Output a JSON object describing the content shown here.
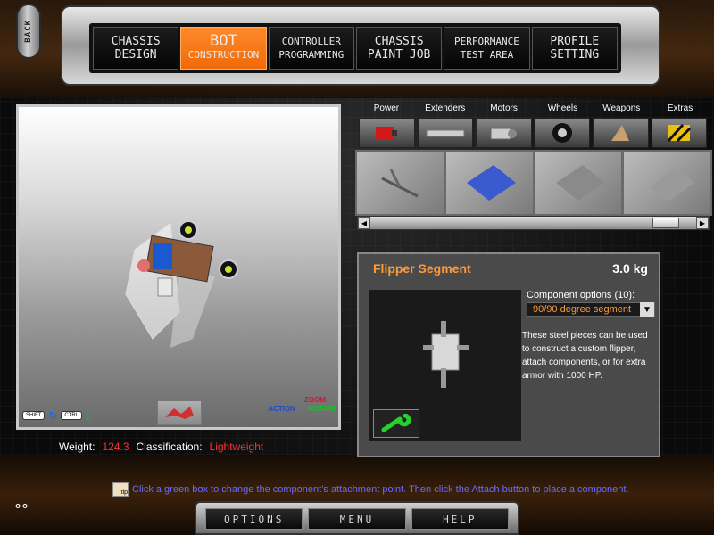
{
  "back_label": "BACK",
  "nav_tabs": [
    {
      "line1": "CHASSIS",
      "line2": "DESIGN",
      "active": false
    },
    {
      "line1": "BOT",
      "line2": "CONSTRUCTION",
      "active": true
    },
    {
      "line1": "CONTROLLER",
      "line2": "PROGRAMMING",
      "active": false
    },
    {
      "line1": "CHASSIS",
      "line2": "PAINT JOB",
      "active": false
    },
    {
      "line1": "PERFORMANCE",
      "line2": "TEST AREA",
      "active": false
    },
    {
      "line1": "PROFILE",
      "line2": "SETTING",
      "active": false
    }
  ],
  "viewport": {
    "shift_key": "SHIFT",
    "ctrl_key": "CTRL",
    "action_label": "ACTION",
    "zoom_label": "ZOOM",
    "rotate_label": "ROTATE"
  },
  "stats": {
    "weight_label": "Weight:",
    "weight_value": "124.3",
    "class_label": "Classification:",
    "class_value": "Lightweight"
  },
  "categories": [
    "Power",
    "Extenders",
    "Motors",
    "Wheels",
    "Weapons",
    "Extras"
  ],
  "detail": {
    "title": "Flipper Segment",
    "weight": "3.0 kg",
    "options_label": "Component options (10):",
    "selected_option": "90/90 degree segment",
    "description": "These steel pieces can be used to construct a custom flipper, attach components, or for extra armor with 1000 HP."
  },
  "tip": {
    "icon_text": "tip",
    "text": "Click a green box to change the component's attachment point.  Then click the Attach button to place a component."
  },
  "bottom_buttons": [
    "OPTIONS",
    "MENU",
    "HELP"
  ],
  "colors": {
    "accent": "#f07a1a",
    "weight_value": "#ff3030",
    "title_orange": "#ff9a3a",
    "tip_text": "#6a6aff"
  }
}
